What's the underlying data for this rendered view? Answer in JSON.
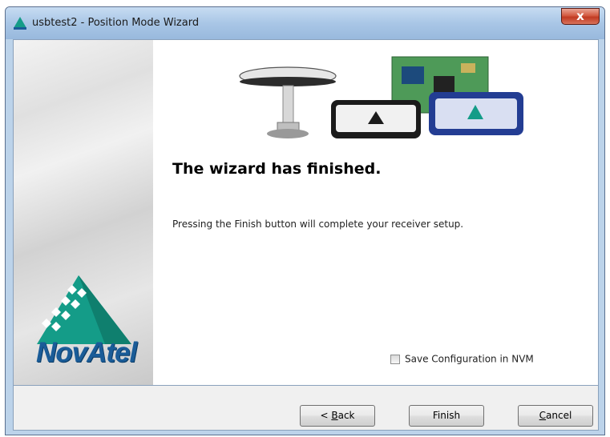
{
  "window": {
    "title": "usbtest2 - Position Mode Wizard",
    "close_label": "x"
  },
  "sidebar": {
    "brand": "NovAtel"
  },
  "main": {
    "heading": "The wizard has finished.",
    "description": "Pressing the Finish button will complete your receiver setup.",
    "save_nvm_label": "Save Configuration in NVM",
    "save_nvm_checked": false
  },
  "footer": {
    "back_prefix": "< ",
    "back_mnemonic": "B",
    "back_rest": "ack",
    "finish_label": "Finish",
    "cancel_mnemonic": "C",
    "cancel_rest": "ancel"
  },
  "colors": {
    "titlebar": "#a9c6e6",
    "close_button": "#c13a22",
    "brand_green": "#149c88",
    "brand_blue": "#1a5c98"
  }
}
